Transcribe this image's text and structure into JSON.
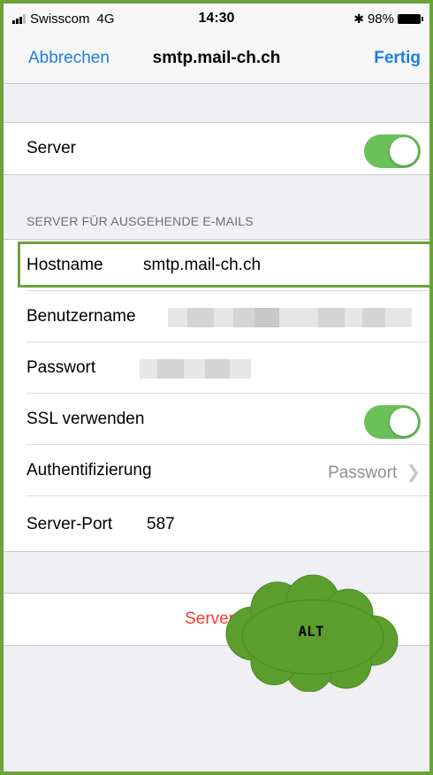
{
  "status": {
    "carrier": "Swisscom",
    "network": "4G",
    "time": "14:30",
    "battery": "98%"
  },
  "nav": {
    "cancel": "Abbrechen",
    "title": "smtp.mail-ch.ch",
    "done": "Fertig"
  },
  "server_row": {
    "label": "Server",
    "enabled": true
  },
  "section_header": "SERVER FÜR AUSGEHENDE E-MAILS",
  "fields": {
    "hostname_label": "Hostname",
    "hostname_value": "smtp.mail-ch.ch",
    "username_label": "Benutzername",
    "password_label": "Passwort",
    "ssl_label": "SSL verwenden",
    "ssl_enabled": true,
    "auth_label": "Authentifizierung",
    "auth_value": "Passwort",
    "port_label": "Server-Port",
    "port_value": "587"
  },
  "delete_button": "Server e",
  "annotation": {
    "text": "ALT",
    "color": "#5c9e2e"
  },
  "colors": {
    "accent": "#1a7ee8",
    "toggle_on": "#6ac15a",
    "destructive": "#ff3b30",
    "frame": "#6aa339"
  }
}
